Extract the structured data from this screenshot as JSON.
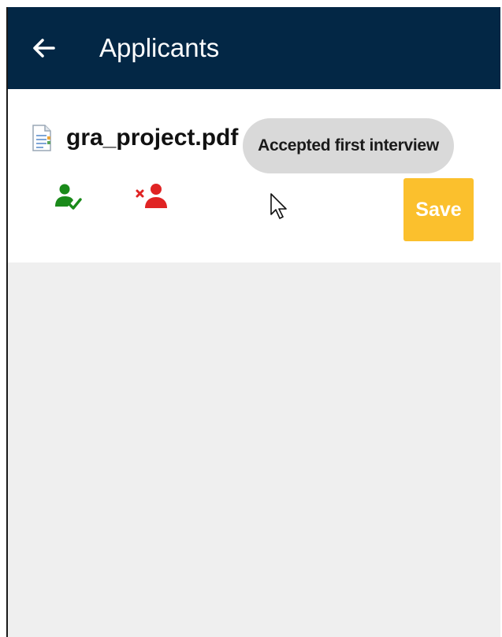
{
  "appbar": {
    "title": "Applicants",
    "back_icon": "arrow-left-icon",
    "background": "#032745"
  },
  "application": {
    "file_name": "gra_project.pdf",
    "file_icon": "document-icon",
    "status_tooltip": "Accepted first interview",
    "accept_icon": "person-check-icon",
    "reject_icon": "person-remove-icon",
    "accept_color": "#1a8a1a",
    "reject_color": "#e02424",
    "save_label": "Save",
    "save_color": "#fbc02d"
  }
}
